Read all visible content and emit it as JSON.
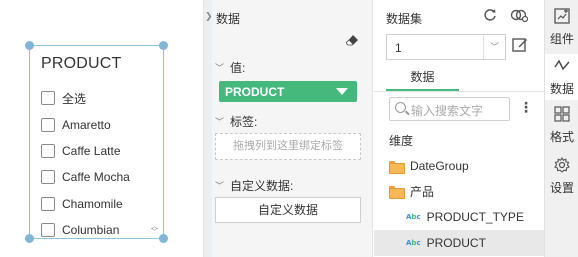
{
  "canvas": {
    "widget_title": "PRODUCT",
    "checkbox_items": [
      "全选",
      "Amaretto",
      "Caffe Latte",
      "Caffe Mocha",
      "Chamomile",
      "Columbian"
    ]
  },
  "data_panel": {
    "title": "数据",
    "eraser_icon": "eraser-icon",
    "value_label": "值:",
    "value_field": "PRODUCT",
    "tag_label": "标签:",
    "tag_placeholder": "拖拽列到这里绑定标签",
    "custom_label": "自定义数据:",
    "custom_button": "自定义数据"
  },
  "dataset_panel": {
    "title": "数据集",
    "refresh_icon": "refresh-icon",
    "link_icon": "dataset-link-icon",
    "selected_dataset": "1",
    "edit_icon": "edit-icon",
    "tab_label": "数据",
    "search_placeholder": "输入搜索文字",
    "dimension_label": "维度",
    "tree": [
      {
        "label": "DateGroup",
        "kind": "folder"
      },
      {
        "label": "产品",
        "kind": "folder"
      },
      {
        "label": "PRODUCT_TYPE",
        "kind": "field"
      },
      {
        "label": "PRODUCT",
        "kind": "field",
        "selected": true
      }
    ]
  },
  "side_tabs": [
    {
      "label": "组件",
      "icon": "component-icon"
    },
    {
      "label": "数据",
      "icon": "data-icon",
      "active": true
    },
    {
      "label": "格式",
      "icon": "format-icon"
    },
    {
      "label": "设置",
      "icon": "settings-icon"
    }
  ],
  "colors": {
    "accent": "#45b97c",
    "selection_handle": "#7fb6d6",
    "folder": "#f7b955",
    "field_type": "#3d8ed8"
  }
}
